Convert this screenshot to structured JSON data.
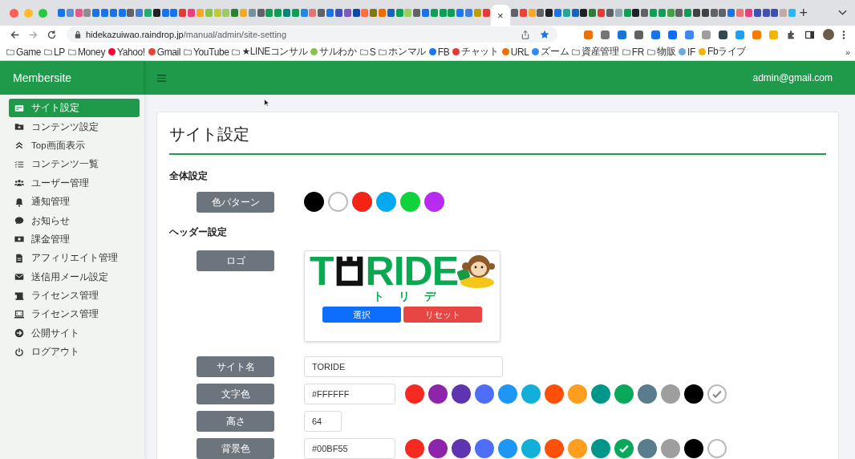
{
  "browser": {
    "tabs": [
      {
        "color": "#1a73e8",
        "selected": false
      },
      {
        "color": "#5c8fd6",
        "selected": false
      },
      {
        "color": "#e05a8a",
        "selected": false
      },
      {
        "color": "#8d8d8d",
        "selected": false
      },
      {
        "color": "#1a73e8",
        "selected": false
      },
      {
        "color": "#1a73e8",
        "selected": false
      },
      {
        "color": "#1a73e8",
        "selected": false
      },
      {
        "color": "#1a73e8",
        "selected": false
      },
      {
        "color": "#5f6368",
        "selected": false
      },
      {
        "color": "#3f7fd9",
        "selected": false
      },
      {
        "color": "#2aa876",
        "selected": false
      },
      {
        "color": "#202124",
        "selected": false
      },
      {
        "color": "#1a73e8",
        "selected": false
      },
      {
        "color": "#1a73e8",
        "selected": false
      },
      {
        "color": "#e53935",
        "selected": false
      },
      {
        "color": "#ec407a",
        "selected": false
      },
      {
        "color": "#f9a825",
        "selected": false
      },
      {
        "color": "#8bc34a",
        "selected": false
      },
      {
        "color": "#c0ca33",
        "selected": false
      },
      {
        "color": "#9ccc65",
        "selected": false
      },
      {
        "color": "#2e7d32",
        "selected": false
      },
      {
        "color": "#f9a825",
        "selected": false
      },
      {
        "color": "#78909c",
        "selected": false
      },
      {
        "color": "#5f6368",
        "selected": false
      },
      {
        "color": "#0f9d58",
        "selected": false
      },
      {
        "color": "#0f9d58",
        "selected": false
      },
      {
        "color": "#00897b",
        "selected": false
      },
      {
        "color": "#0f9d58",
        "selected": false
      },
      {
        "color": "#1e88e5",
        "selected": false
      },
      {
        "color": "#e57373",
        "selected": false
      },
      {
        "color": "#5f6368",
        "selected": false
      },
      {
        "color": "#1a73e8",
        "selected": false
      },
      {
        "color": "#3f51b5",
        "selected": false
      },
      {
        "color": "#7e57c2",
        "selected": false
      },
      {
        "color": "#0d47a1",
        "selected": false
      },
      {
        "color": "#ff7043",
        "selected": false
      },
      {
        "color": "#827717",
        "selected": false
      },
      {
        "color": "#ef6c00",
        "selected": false
      },
      {
        "color": "#1565c0",
        "selected": false
      },
      {
        "color": "#0f9d58",
        "selected": false
      },
      {
        "color": "#9ccc65",
        "selected": false
      },
      {
        "color": "#5f6368",
        "selected": false
      },
      {
        "color": "#1a73e8",
        "selected": false
      },
      {
        "color": "#0f9d58",
        "selected": false
      },
      {
        "color": "#0f9d58",
        "selected": false
      },
      {
        "color": "#0f9d58",
        "selected": false
      },
      {
        "color": "#1877f2",
        "selected": false
      },
      {
        "color": "#3f7fd9",
        "selected": false
      },
      {
        "color": "#c0a000",
        "selected": false
      },
      {
        "color": "#e53935",
        "selected": false
      },
      {
        "close_label": "×",
        "selected": true
      },
      {
        "color": "#5f6368",
        "selected": false
      },
      {
        "color": "#ea4335",
        "selected": false
      },
      {
        "color": "#f9a825",
        "selected": false
      },
      {
        "color": "#5f6368",
        "selected": false
      },
      {
        "color": "#202124",
        "selected": false
      },
      {
        "color": "#1a73e8",
        "selected": false
      },
      {
        "color": "#26a69a",
        "selected": false
      },
      {
        "color": "#1565c0",
        "selected": false
      },
      {
        "color": "#202124",
        "selected": false
      },
      {
        "color": "#2e7d32",
        "selected": false
      },
      {
        "color": "#e53935",
        "selected": false
      },
      {
        "color": "#5f6368",
        "selected": false
      },
      {
        "color": "#90a4ae",
        "selected": false
      },
      {
        "color": "#0f9d58",
        "selected": false
      },
      {
        "color": "#202124",
        "selected": false
      },
      {
        "color": "#5f6368",
        "selected": false
      },
      {
        "color": "#0f9d58",
        "selected": false
      },
      {
        "color": "#0f9d58",
        "selected": false
      },
      {
        "color": "#43a047",
        "selected": false
      },
      {
        "color": "#5f6368",
        "selected": false
      },
      {
        "color": "#0f9d58",
        "selected": false
      },
      {
        "color": "#424242",
        "selected": false
      },
      {
        "color": "#424242",
        "selected": false
      },
      {
        "color": "#5f6368",
        "selected": false
      },
      {
        "color": "#5f6368",
        "selected": false
      },
      {
        "color": "#1a73e8",
        "selected": false
      },
      {
        "color": "#e57373",
        "selected": false
      },
      {
        "color": "#ec407a",
        "selected": false
      },
      {
        "color": "#3f51b5",
        "selected": false
      },
      {
        "color": "#3f51b5",
        "selected": false
      },
      {
        "color": "#3f51b5",
        "selected": false
      },
      {
        "color": "#bcaaa4",
        "selected": false
      },
      {
        "color": "#29b6f6",
        "selected": false
      }
    ],
    "new_tab_label": "+",
    "url_host": "hidekazuiwao.raindrop.jp",
    "url_path": "/manual/admin/site-setting",
    "extensions": [
      {
        "color": "#e8710a"
      },
      {
        "color": "#757575"
      },
      {
        "color": "#1976d2"
      },
      {
        "color": "#616161"
      },
      {
        "color": "#1a73e8"
      },
      {
        "color": "#0d6efd"
      },
      {
        "color": "#4285f4"
      },
      {
        "color": "#9e9e9e"
      },
      {
        "color": "#37474f"
      },
      {
        "color": "#1da1f2"
      },
      {
        "color": "#f57c00"
      },
      {
        "color": "#f4b400"
      }
    ],
    "bookmarks": [
      {
        "label": "Game",
        "kind": "folder"
      },
      {
        "label": "LP",
        "kind": "folder"
      },
      {
        "label": "Money",
        "kind": "folder"
      },
      {
        "label": "Yahoo!",
        "kind": "site",
        "color": "#ff0033"
      },
      {
        "label": "Gmail",
        "kind": "site",
        "color": "#ea4335"
      },
      {
        "label": "YouTube",
        "kind": "folder"
      },
      {
        "label": "★LINEコンサル",
        "kind": "folder"
      },
      {
        "label": "サルわか",
        "kind": "site",
        "color": "#8bc34a"
      },
      {
        "label": "S",
        "kind": "folder"
      },
      {
        "label": "ホンマル",
        "kind": "folder"
      },
      {
        "label": "FB",
        "kind": "site",
        "color": "#1877f2"
      },
      {
        "label": "チャット",
        "kind": "site",
        "color": "#e53935"
      },
      {
        "label": "URL",
        "kind": "site",
        "color": "#e8710a"
      },
      {
        "label": "ズーム",
        "kind": "site",
        "color": "#2d8cff"
      },
      {
        "label": "資産管理",
        "kind": "folder"
      },
      {
        "label": "FR",
        "kind": "folder"
      },
      {
        "label": "物販",
        "kind": "folder"
      },
      {
        "label": "IF",
        "kind": "site",
        "color": "#6fa8dc"
      },
      {
        "label": "Fbライブ",
        "kind": "site",
        "color": "#f4b400"
      }
    ],
    "more_bookmarks": "»"
  },
  "app": {
    "brand": "Membersite",
    "user": "admin@gmail.com"
  },
  "sidebar": {
    "items": [
      {
        "label": "サイト設定",
        "kind": "card",
        "selected": true
      },
      {
        "label": "コンテンツ設定",
        "kind": "folder",
        "selected": false
      },
      {
        "label": "Top画面表示",
        "kind": "chevrons",
        "selected": false
      },
      {
        "label": "コンテンツ一覧",
        "kind": "list",
        "selected": false
      },
      {
        "label": "ユーザー管理",
        "kind": "users",
        "selected": false
      },
      {
        "label": "通知管理",
        "kind": "bell",
        "selected": false
      },
      {
        "label": "お知らせ",
        "kind": "comment",
        "selected": false
      },
      {
        "label": "課金管理",
        "kind": "money",
        "selected": false
      },
      {
        "label": "アフィリエイト管理",
        "kind": "file",
        "selected": false
      },
      {
        "label": "送信用メール設定",
        "kind": "envelope",
        "selected": false
      },
      {
        "label": "ライセンス管理",
        "kind": "scroll",
        "selected": false
      },
      {
        "label": "ライセンス管理",
        "kind": "laptop",
        "selected": false
      },
      {
        "label": "公開サイト",
        "kind": "arrow",
        "selected": false
      },
      {
        "label": "ログアウト",
        "kind": "power",
        "selected": false
      }
    ]
  },
  "page": {
    "title": "サイト設定",
    "sections": [
      {
        "heading": "全体設定",
        "rows": [
          {
            "label": "色パターン",
            "kind": "palette",
            "swatches": [
              {
                "color": "#000000"
              },
              {
                "color": "#ffffff"
              },
              {
                "color": "#f52314"
              },
              {
                "color": "#00aaf0"
              },
              {
                "color": "#0fd23c"
              },
              {
                "color": "#b72cf0"
              }
            ]
          }
        ]
      },
      {
        "heading": "ヘッダー設定",
        "rows": [
          {
            "label": "ロゴ",
            "kind": "logo",
            "logo_left": "T",
            "logo_right": "RIDE",
            "logo_kana": "トリデ",
            "buttons": [
              {
                "label": "選択",
                "kind": "primary"
              },
              {
                "label": "リセット",
                "kind": "danger"
              }
            ]
          },
          {
            "label": "サイト名",
            "kind": "text",
            "value": "TORIDE"
          },
          {
            "label": "文字色",
            "kind": "color",
            "value": "#FFFFFF",
            "swatches": [
              {
                "color": "#f62a20",
                "selected": false
              },
              {
                "color": "#8e24aa",
                "selected": false
              },
              {
                "color": "#5e35b1",
                "selected": false
              },
              {
                "color": "#4f6ef7",
                "selected": false
              },
              {
                "color": "#1e96f3",
                "selected": false
              },
              {
                "color": "#12b0d8",
                "selected": false
              },
              {
                "color": "#ff5009",
                "selected": false
              },
              {
                "color": "#ff9d1e",
                "selected": false
              },
              {
                "color": "#00968a",
                "selected": false
              },
              {
                "color": "#0aa85b",
                "selected": false
              },
              {
                "color": "#5a7c8f",
                "selected": false
              },
              {
                "color": "#9e9e9e",
                "selected": false
              },
              {
                "color": "#000000",
                "selected": false
              },
              {
                "color": "#ffffff",
                "selected": true
              }
            ]
          },
          {
            "label": "高さ",
            "kind": "number",
            "value": "64"
          },
          {
            "label": "背景色",
            "kind": "color",
            "value": "#00BF55",
            "swatches": [
              {
                "color": "#f62a20",
                "selected": false
              },
              {
                "color": "#8e24aa",
                "selected": false
              },
              {
                "color": "#5e35b1",
                "selected": false
              },
              {
                "color": "#4f6ef7",
                "selected": false
              },
              {
                "color": "#1e96f3",
                "selected": false
              },
              {
                "color": "#12b0d8",
                "selected": false
              },
              {
                "color": "#ff5009",
                "selected": false
              },
              {
                "color": "#ff9d1e",
                "selected": false
              },
              {
                "color": "#00968a",
                "selected": false
              },
              {
                "color": "#0aa85b",
                "selected": true
              },
              {
                "color": "#5a7c8f",
                "selected": false
              },
              {
                "color": "#9e9e9e",
                "selected": false
              },
              {
                "color": "#000000",
                "selected": false
              },
              {
                "color": "#ffffff",
                "selected": false
              }
            ]
          }
        ]
      }
    ]
  }
}
